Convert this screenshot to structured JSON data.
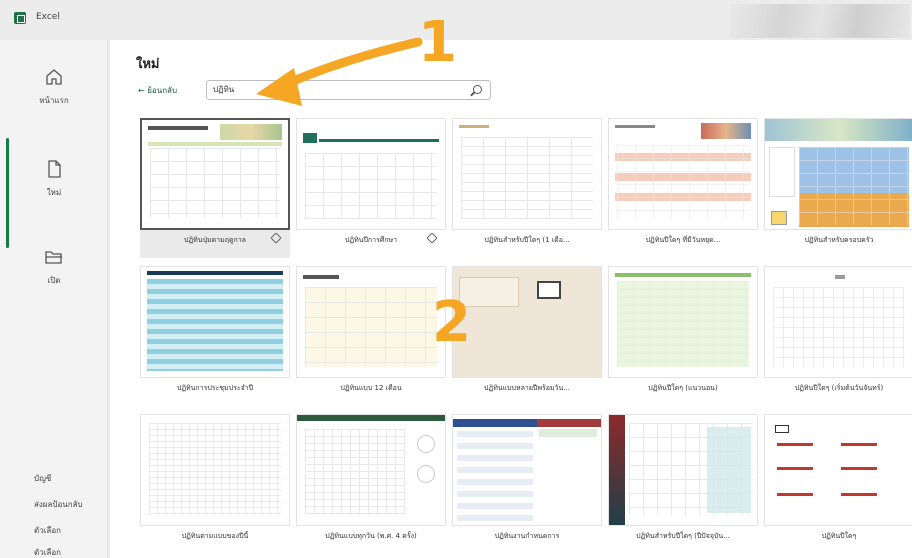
{
  "window": {
    "app_title": "Excel"
  },
  "rail": {
    "items": [
      {
        "label": "หน้าแรก",
        "icon": "home-icon"
      },
      {
        "label": "ใหม่",
        "icon": "new-file-icon"
      },
      {
        "label": "เปิด",
        "icon": "open-folder-icon"
      }
    ],
    "bottom": [
      "บัญชี",
      "ส่งผลป้อนกลับ",
      "ตัวเลือก",
      "ตัวเลือก"
    ]
  },
  "main": {
    "title": "ใหม่",
    "back_label": "← ย้อนกลับ",
    "search_value": "ปฏิทิน"
  },
  "templates": [
    {
      "caption": "ปฏิทินปุ่มตามฤดูกาล",
      "selected": true,
      "pinned": true
    },
    {
      "caption": "ปฏิทินปีการศึกษา",
      "selected": false,
      "pinned": true
    },
    {
      "caption": "ปฏิทินสำหรับปีใดๆ (1 เดือ...",
      "selected": false,
      "pinned": false
    },
    {
      "caption": "ปฏิทินปีใดๆ ที่มีวันหยุด...",
      "selected": false,
      "pinned": false
    },
    {
      "caption": "ปฏิทินสำหรับครอบครัว",
      "selected": false,
      "pinned": false
    },
    {
      "caption": "ปฏิทินการประชุมประจำปี",
      "selected": false,
      "pinned": false
    },
    {
      "caption": "ปฏิทินแบบ 12 เดือน",
      "selected": false,
      "pinned": false
    },
    {
      "caption": "ปฏิทินแบบหลายปีพร้อมวัน...",
      "selected": false,
      "pinned": false
    },
    {
      "caption": "ปฏิทินปีใดๆ (แนวนอน)",
      "selected": false,
      "pinned": false
    },
    {
      "caption": "ปฏิทินปีใดๆ (เริ่มต้นวันจันทร์)",
      "selected": false,
      "pinned": false
    },
    {
      "caption": "ปฏิทินตามแบบของปีนี้",
      "selected": false,
      "pinned": false
    },
    {
      "caption": "ปฏิทินแบบทุกวัน (พ.ศ. 4 ครั้ง)",
      "selected": false,
      "pinned": false
    },
    {
      "caption": "ปฏิทินงานกำหนดการ",
      "selected": false,
      "pinned": false
    },
    {
      "caption": "ปฏิทินสำหรับปีใดๆ (ปีปัจจุบัน...",
      "selected": false,
      "pinned": false
    },
    {
      "caption": "ปฏิทินปีใดๆ",
      "selected": false,
      "pinned": false
    }
  ],
  "annotations": {
    "one": "1",
    "two": "2"
  },
  "colors": {
    "accent": "#107c41",
    "annotation": "#f5a623"
  }
}
